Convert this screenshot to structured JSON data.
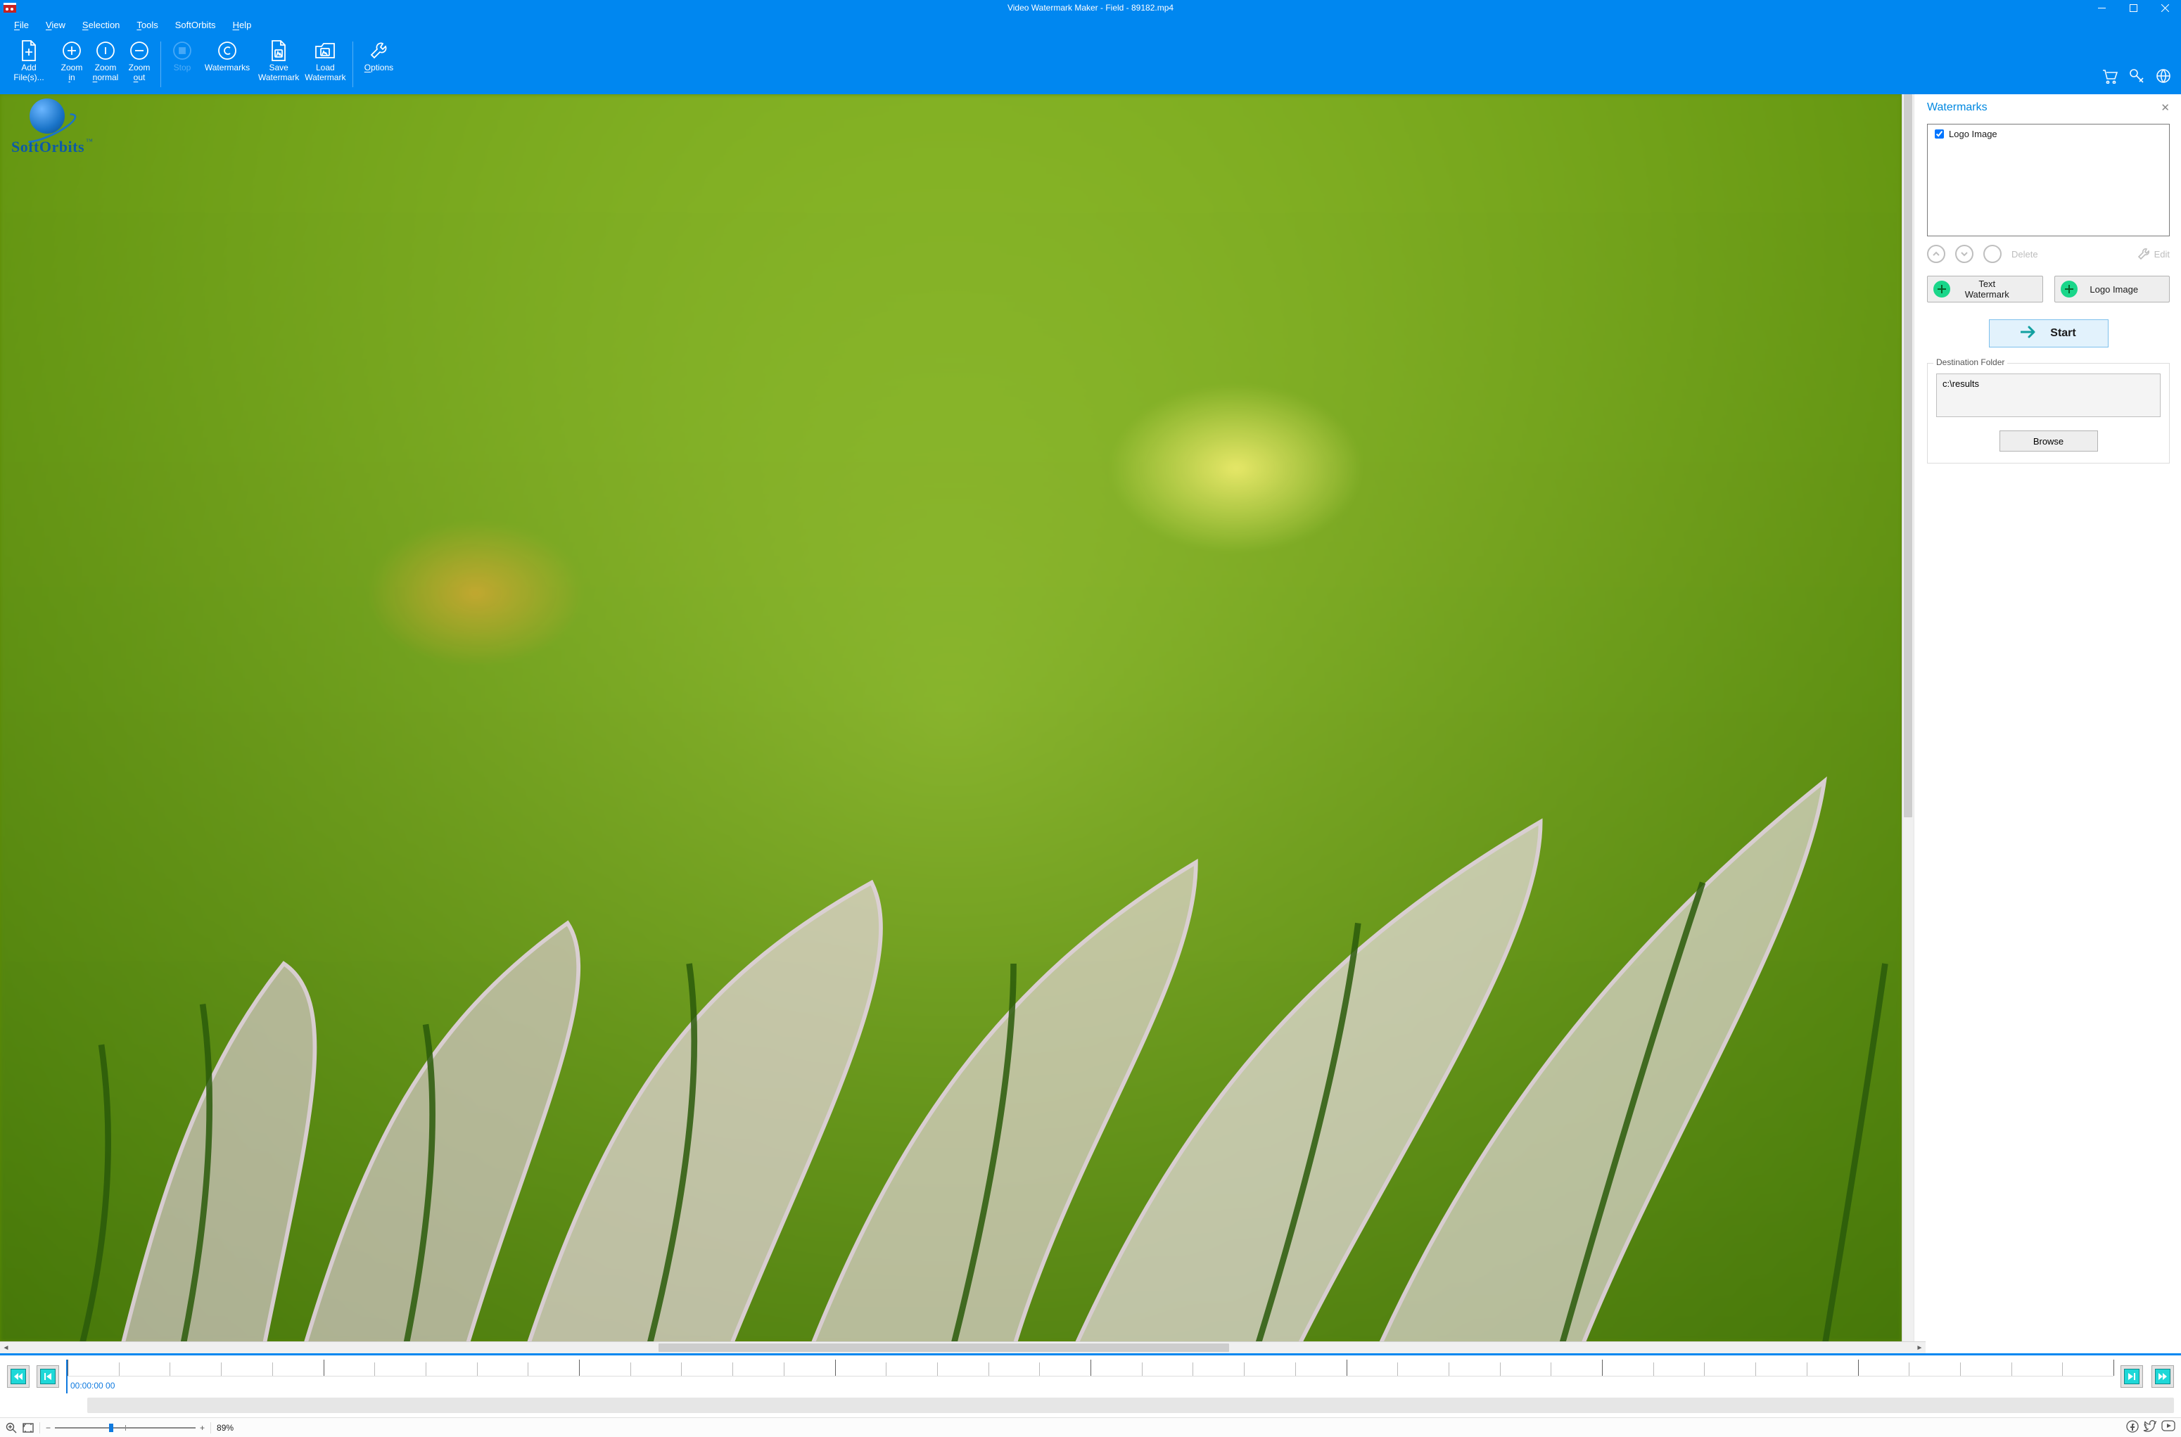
{
  "titlebar": {
    "title": "Video Watermark Maker - Field - 89182.mp4"
  },
  "menu": [
    {
      "hotkey": "F",
      "rest": "ile"
    },
    {
      "hotkey": "V",
      "rest": "iew"
    },
    {
      "hotkey": "S",
      "rest": "election"
    },
    {
      "hotkey": "T",
      "rest": "ools"
    },
    {
      "hotkey": "",
      "rest": "SoftOrbits"
    },
    {
      "hotkey": "H",
      "rest": "elp"
    }
  ],
  "toolbar": {
    "add_label": "Add File(s)...",
    "zoomin": {
      "l1": "Zoom",
      "l2": "in",
      "hot": "i"
    },
    "zoomnormal": {
      "l1": "Zoom",
      "l2": "normal",
      "hot": "n"
    },
    "zoomout": {
      "l1": "Zoom",
      "l2": "out",
      "hot": "o"
    },
    "stop_label": "Stop",
    "watermarks_label": "Watermarks",
    "savewm": {
      "l1": "Save",
      "l2": "Watermark"
    },
    "loadwm": {
      "l1": "Load",
      "l2": "Watermark"
    },
    "options_label": "Options"
  },
  "overlay": {
    "brand": "SoftOrbits",
    "tm": "™"
  },
  "sidepanel": {
    "title": "Watermarks",
    "items": [
      {
        "label": "Logo Image",
        "checked": true
      }
    ],
    "delete_label": "Delete",
    "edit_label": "Edit",
    "text_wm_label": "Text Watermark",
    "logo_wm_label": "Logo Image",
    "start_label": "Start",
    "dest_legend": "Destination Folder",
    "dest_value": "c:\\results",
    "browse_label": "Browse"
  },
  "timeline": {
    "timecode": "00:00:00 00"
  },
  "statusbar": {
    "zoom_pct": "89%",
    "slider_pos_pct": 40
  }
}
